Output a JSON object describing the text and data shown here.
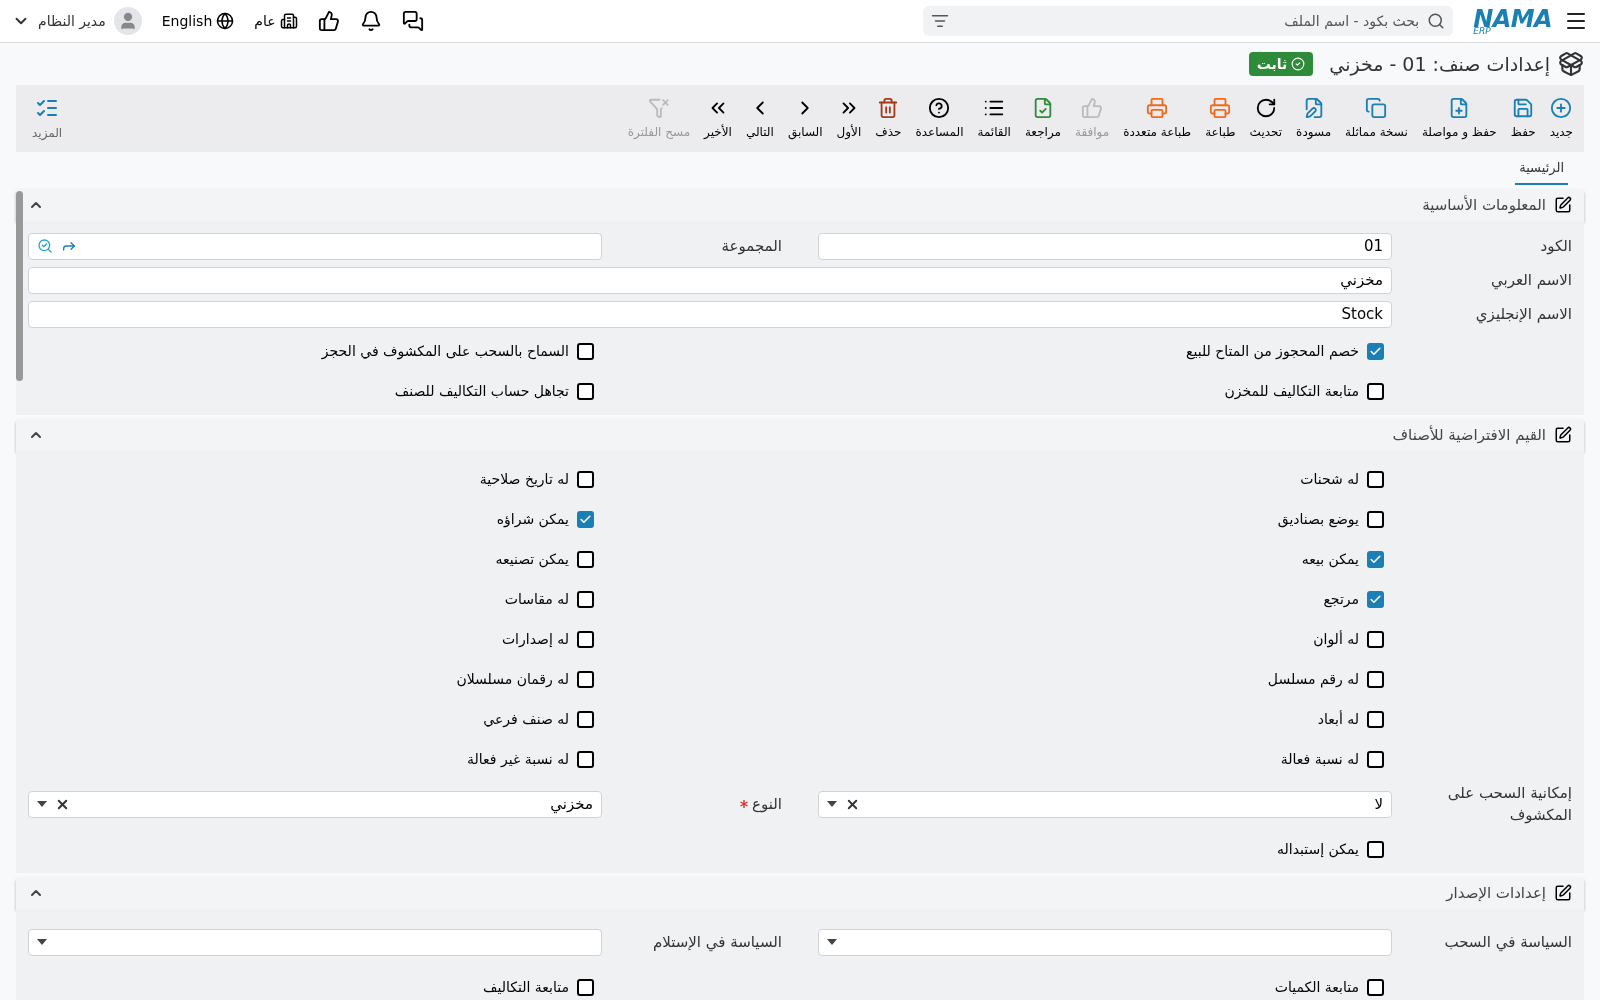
{
  "topbar": {
    "logo": "NAMA",
    "logo_sub": "ERP",
    "search": {
      "placeholder": "بحث بكود - اسم الملف"
    },
    "branch": "عام",
    "language": "English",
    "user": "مدير النظام"
  },
  "page": {
    "title": "إعدادات صنف: 01 - مخزني",
    "status": "ثابت"
  },
  "toolbar": [
    {
      "label": "جديد",
      "disabled": false
    },
    {
      "label": "حفظ",
      "disabled": false
    },
    {
      "label": "حفظ و مواصلة",
      "disabled": false
    },
    {
      "label": "نسخة مماثلة",
      "disabled": false
    },
    {
      "label": "مسودة",
      "disabled": false
    },
    {
      "label": "تحديث",
      "disabled": false
    },
    {
      "label": "طباعة",
      "disabled": false
    },
    {
      "label": "طباعة متعددة",
      "disabled": false
    },
    {
      "label": "موافقة",
      "disabled": true
    },
    {
      "label": "مراجعة",
      "disabled": false
    },
    {
      "label": "القائمة",
      "disabled": false
    },
    {
      "label": "المساعدة",
      "disabled": false
    },
    {
      "label": "حذف",
      "disabled": false
    },
    {
      "label": "الأول",
      "disabled": false
    },
    {
      "label": "السابق",
      "disabled": false
    },
    {
      "label": "التالي",
      "disabled": false
    },
    {
      "label": "الأخير",
      "disabled": false
    },
    {
      "label": "مسح الفلترة",
      "disabled": true
    }
  ],
  "more": {
    "label": "المزيد"
  },
  "tabs": [
    {
      "label": "الرئيسية",
      "selected": true
    }
  ],
  "sections": [
    {
      "title": "المعلومات الأساسية",
      "expanded": true,
      "rows": [
        [
          {
            "kind": "field",
            "label": "الكود",
            "value": "01"
          },
          {
            "kind": "lookup",
            "label": "المجموعة"
          }
        ],
        [
          {
            "kind": "wide",
            "label": "الاسم العربي",
            "value": "مخزني"
          }
        ],
        [
          {
            "kind": "wide",
            "label": "الاسم الإنجليزي",
            "value": "Stock"
          }
        ],
        [
          {
            "kind": "check",
            "label": "خصم المحجوز من المتاح للبيع",
            "checked": true
          },
          {
            "kind": "check",
            "label": "السماح بالسحب على المكشوف في الحجز",
            "checked": false
          }
        ],
        [
          {
            "kind": "check",
            "label": "متابعة التكاليف للمخزن",
            "checked": false
          },
          {
            "kind": "check",
            "label": "تجاهل حساب التكاليف للصنف",
            "checked": false
          }
        ]
      ]
    },
    {
      "title": "القيم الافتراضية للأصناف",
      "expanded": true,
      "rows": [
        [
          {
            "kind": "check",
            "label": "له شحنات",
            "checked": false
          },
          {
            "kind": "check",
            "label": "له تاريخ صلاحية",
            "checked": false
          }
        ],
        [
          {
            "kind": "check",
            "label": "يوضع بصناديق",
            "checked": false
          },
          {
            "kind": "check",
            "label": "يمكن شراؤه",
            "checked": true
          }
        ],
        [
          {
            "kind": "check",
            "label": "يمكن بيعه",
            "checked": true
          },
          {
            "kind": "check",
            "label": "يمكن تصنيعه",
            "checked": false
          }
        ],
        [
          {
            "kind": "check",
            "label": "مرتجع",
            "checked": true
          },
          {
            "kind": "check",
            "label": "له مقاسات",
            "checked": false
          }
        ],
        [
          {
            "kind": "check",
            "label": "له ألوان",
            "checked": false
          },
          {
            "kind": "check",
            "label": "له إصدارات",
            "checked": false
          }
        ],
        [
          {
            "kind": "check",
            "label": "له رقم مسلسل",
            "checked": false
          },
          {
            "kind": "check",
            "label": "له رقمان مسلسلان",
            "checked": false
          }
        ],
        [
          {
            "kind": "check",
            "label": "له أبعاد",
            "checked": false
          },
          {
            "kind": "check",
            "label": "له صنف فرعي",
            "checked": false
          }
        ],
        [
          {
            "kind": "check",
            "label": "له نسبة فعالة",
            "checked": false
          },
          {
            "kind": "check",
            "label": "له نسبة غير فعالة",
            "checked": false
          }
        ],
        [
          {
            "kind": "select",
            "label": "إمكانية السحب على المكشوف",
            "value": "لا",
            "required": false
          },
          {
            "kind": "select",
            "label": "النوع",
            "value": "مخزني",
            "required": true
          }
        ],
        [
          {
            "kind": "check",
            "label": "يمكن إستبداله",
            "checked": false
          }
        ]
      ]
    },
    {
      "title": "إعدادات الإصدار",
      "expanded": true,
      "rows": [
        [
          {
            "kind": "select",
            "label": "السياسة في السحب",
            "required": false
          },
          {
            "kind": "select",
            "label": "السياسة في الإستلام",
            "required": false
          }
        ],
        [
          {
            "kind": "check",
            "label": "متابعة الكميات",
            "checked": false
          },
          {
            "kind": "check",
            "label": "متابعة التكاليف",
            "checked": false
          }
        ]
      ]
    }
  ]
}
